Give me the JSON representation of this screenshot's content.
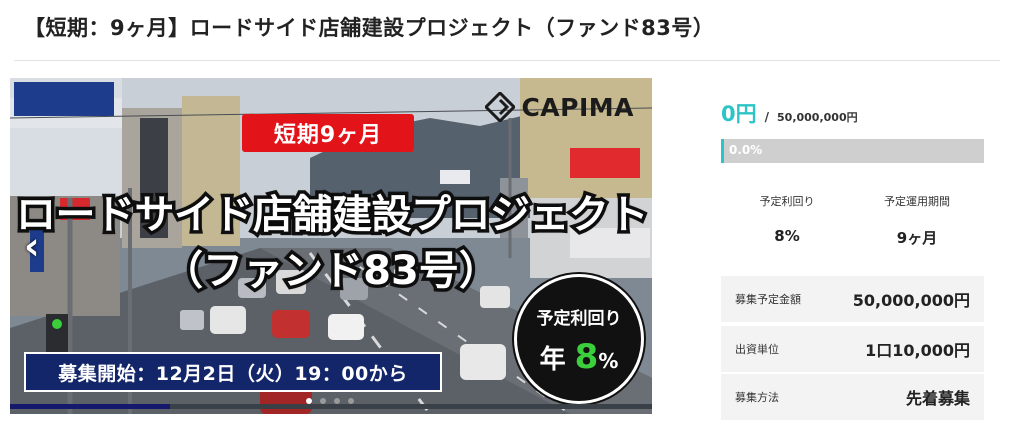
{
  "page": {
    "title": "【短期：9ヶ月】ロードサイド店舗建設プロジェクト（ファンド83号）"
  },
  "banner": {
    "brand": "CAPIMA",
    "badge": "短期9ヶ月",
    "headline_line1": "ロードサイド店舗建設プロジェクト",
    "headline_line2": "（ファンド83号）",
    "rate_label": "予定利回り",
    "rate_prefix": "年",
    "rate_value": "8",
    "rate_unit": "%",
    "start_text": "募集開始：12月2日（火）19：00から",
    "prev_arrow": "‹",
    "slide_count": 4,
    "active_slide": 1
  },
  "funding": {
    "raised": "0円",
    "separator": "/",
    "goal": "50,000,000円",
    "progress_label": "0.0%",
    "progress_fraction": 0.0
  },
  "stats": {
    "yield_label": "予定利回り",
    "yield_value": "8%",
    "period_label": "予定運用期間",
    "period_value": "9ヶ月"
  },
  "details": [
    {
      "label": "募集予定金額",
      "value": "50,000,000円"
    },
    {
      "label": "出資単位",
      "value": "1口10,000円"
    },
    {
      "label": "募集方法",
      "value": "先着募集"
    }
  ],
  "colors": {
    "accent": "#2cc4c7",
    "badge_red": "#e3131a",
    "navy": "#14266a",
    "rate_green": "#3ccf3c"
  }
}
